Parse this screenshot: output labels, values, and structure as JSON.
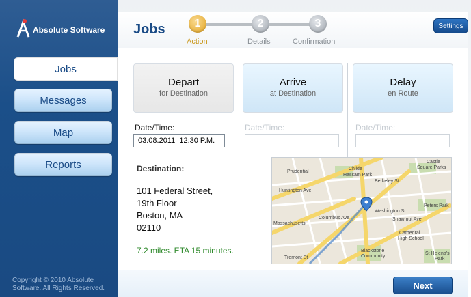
{
  "brand": {
    "name": "Absolute Software"
  },
  "sidebar": {
    "items": [
      {
        "label": "Jobs",
        "active": true
      },
      {
        "label": "Messages",
        "active": false
      },
      {
        "label": "Map",
        "active": false
      },
      {
        "label": "Reports",
        "active": false
      }
    ],
    "copyright": [
      "Copyright © 2010 Absolute",
      "Software. All Rights Reserved."
    ]
  },
  "header": {
    "title": "Jobs",
    "steps": [
      {
        "number": "1",
        "label": "Action",
        "active": true
      },
      {
        "number": "2",
        "label": "Details",
        "active": false
      },
      {
        "number": "3",
        "label": "Confirmation",
        "active": false
      }
    ],
    "settings_label": "Settings"
  },
  "actions": {
    "depart": {
      "title": "Depart",
      "subtitle": "for Destination"
    },
    "arrive": {
      "title": "Arrive",
      "subtitle": "at Destination"
    },
    "delay": {
      "title": "Delay",
      "subtitle": "en Route"
    }
  },
  "datetime": {
    "depart": {
      "label": "Date/Time:",
      "value": "03.08.2011  12:30 P.M."
    },
    "arrive": {
      "label": "Date/Time:",
      "value": ""
    },
    "delay": {
      "label": "Date/Time:",
      "value": ""
    }
  },
  "destination": {
    "label": "Destination:",
    "lines": [
      "101 Federal Street,",
      "19th Floor",
      "Boston, MA",
      "02110"
    ],
    "eta": "7.2 miles. ETA 15 minutes."
  },
  "map": {
    "labels": {
      "prudential": "Prudential",
      "childe": "Childe",
      "hassam": "Hassam Park",
      "castle": "Castle",
      "square": "Square Parks",
      "peters": "Peters Park",
      "cathedral": "Cathedral",
      "highschool": "High School",
      "blackstone": "Blackstone",
      "community": "Community",
      "sthelena": "St Helena's",
      "park": "Park",
      "massachusetts": "Massachusetts",
      "tremont": "Tremont St",
      "huntington": "Huntington Ave",
      "columbus": "Columbus Ave",
      "shawmut": "Shawmut Ave",
      "washington": "Washington St",
      "berkeley": "Berkeley St"
    }
  },
  "footer": {
    "next_label": "Next"
  },
  "colors": {
    "brand_blue": "#1a4b86",
    "accent_gold": "#e1a21f",
    "eta_green": "#2f8a2c"
  }
}
